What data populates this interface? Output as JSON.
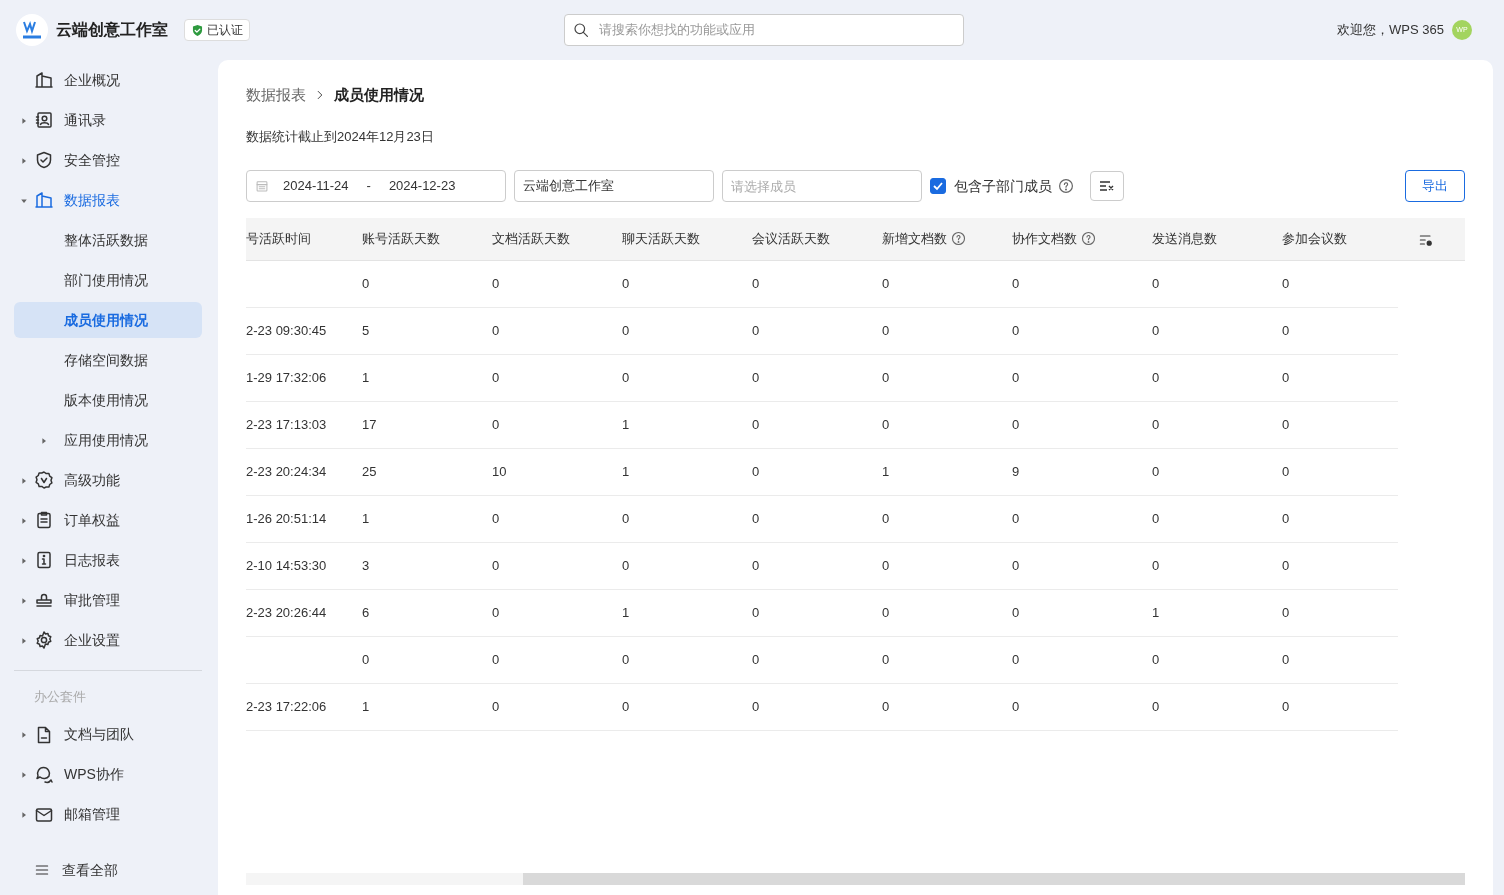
{
  "header": {
    "org_name": "云端创意工作室",
    "verified_badge": "已认证",
    "search": {
      "placeholder": "请搜索你想找的功能或应用"
    },
    "welcome": "欢迎您，WPS 365",
    "avatar": "WP"
  },
  "sidebar": {
    "items": [
      {
        "kind": "building",
        "label": "企业概况",
        "caret": false,
        "expanded": false,
        "selected": false
      },
      {
        "kind": "contacts",
        "label": "通讯录",
        "caret": true,
        "expanded": false,
        "selected": false
      },
      {
        "kind": "shield",
        "label": "安全管控",
        "caret": true,
        "expanded": false,
        "selected": false
      },
      {
        "kind": "building",
        "label": "数据报表",
        "caret": true,
        "expanded": true,
        "selected": false,
        "children": [
          {
            "label": "整体活跃数据",
            "caret": false,
            "selected": false
          },
          {
            "label": "部门使用情况",
            "caret": false,
            "selected": false
          },
          {
            "label": "成员使用情况",
            "caret": false,
            "selected": true
          },
          {
            "label": "存储空间数据",
            "caret": false,
            "selected": false
          },
          {
            "label": "版本使用情况",
            "caret": false,
            "selected": false
          },
          {
            "label": "应用使用情况",
            "caret": true,
            "selected": false
          }
        ]
      },
      {
        "kind": "badge",
        "label": "高级功能",
        "caret": true,
        "expanded": false,
        "selected": false
      },
      {
        "kind": "clipboard",
        "label": "订单权益",
        "caret": true,
        "expanded": false,
        "selected": false
      },
      {
        "kind": "info",
        "label": "日志报表",
        "caret": true,
        "expanded": false,
        "selected": false
      },
      {
        "kind": "stamp",
        "label": "审批管理",
        "caret": true,
        "expanded": false,
        "selected": false
      },
      {
        "kind": "gear",
        "label": "企业设置",
        "caret": true,
        "expanded": false,
        "selected": false
      }
    ],
    "group_label": "办公套件",
    "group_items": [
      {
        "kind": "document",
        "label": "文档与团队",
        "caret": true,
        "expanded": false,
        "selected": false
      },
      {
        "kind": "chat",
        "label": "WPS协作",
        "caret": true,
        "expanded": false,
        "selected": false
      },
      {
        "kind": "mail",
        "label": "邮箱管理",
        "caret": true,
        "expanded": false,
        "selected": false
      }
    ],
    "view_all": "查看全部"
  },
  "breadcrumb": [
    "数据报表",
    "成员使用情况"
  ],
  "stats_note": "数据统计截止到2024年12月23日",
  "filters": {
    "date_start": "2024-11-24",
    "date_separator": "-",
    "date_end": "2024-12-23",
    "department": "云端创意工作室",
    "member": {
      "placeholder": "请选择成员"
    },
    "include_sub": {
      "label": "包含子部门成员",
      "checked": true
    },
    "export": "导出"
  },
  "table": {
    "columns": [
      {
        "label": "号活跃时间",
        "help": false
      },
      {
        "label": "账号活跃天数",
        "help": false
      },
      {
        "label": "文档活跃天数",
        "help": false
      },
      {
        "label": "聊天活跃天数",
        "help": false
      },
      {
        "label": "会议活跃天数",
        "help": false
      },
      {
        "label": "新增文档数",
        "help": true
      },
      {
        "label": "协作文档数",
        "help": true
      },
      {
        "label": "发送消息数",
        "help": false
      },
      {
        "label": "参加会议数",
        "help": false
      }
    ],
    "rows": [
      {
        "cells": [
          null,
          "0",
          "0",
          "0",
          "0",
          "0",
          "0",
          "0",
          "0"
        ]
      },
      {
        "cells": [
          "2-23 09:30:45",
          "5",
          "0",
          "0",
          "0",
          "0",
          "0",
          "0",
          "0"
        ]
      },
      {
        "cells": [
          "1-29 17:32:06",
          "1",
          "0",
          "0",
          "0",
          "0",
          "0",
          "0",
          "0"
        ]
      },
      {
        "cells": [
          "2-23 17:13:03",
          "17",
          "0",
          "1",
          "0",
          "0",
          "0",
          "0",
          "0"
        ]
      },
      {
        "cells": [
          "2-23 20:24:34",
          "25",
          "10",
          "1",
          "0",
          "1",
          "9",
          "0",
          "0"
        ]
      },
      {
        "cells": [
          "1-26 20:51:14",
          "1",
          "0",
          "0",
          "0",
          "0",
          "0",
          "0",
          "0"
        ]
      },
      {
        "cells": [
          "2-10 14:53:30",
          "3",
          "0",
          "0",
          "0",
          "0",
          "0",
          "0",
          "0"
        ]
      },
      {
        "cells": [
          "2-23 20:26:44",
          "6",
          "0",
          "1",
          "0",
          "0",
          "0",
          "1",
          "0"
        ]
      },
      {
        "cells": [
          null,
          "0",
          "0",
          "0",
          "0",
          "0",
          "0",
          "0",
          "0"
        ]
      },
      {
        "cells": [
          "2-23 17:22:06",
          "1",
          "0",
          "0",
          "0",
          "0",
          "0",
          "0",
          "0"
        ]
      }
    ]
  }
}
